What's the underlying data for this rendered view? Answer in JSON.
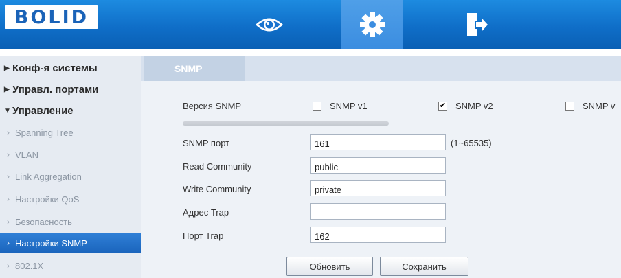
{
  "header": {
    "logo_text": "BOLID",
    "brand_color": "#0f6ec8",
    "tools": [
      {
        "name": "view",
        "icon": "eye-icon"
      },
      {
        "name": "settings",
        "icon": "gear-icon",
        "active": true
      },
      {
        "name": "exit",
        "icon": "exit-door-icon"
      }
    ]
  },
  "sidebar": {
    "groups": [
      {
        "label": "Конф-я системы",
        "expanded": false
      },
      {
        "label": "Управл. портами",
        "expanded": false
      },
      {
        "label": "Управление",
        "expanded": true
      }
    ],
    "items": [
      {
        "label": "Spanning Tree"
      },
      {
        "label": "VLAN"
      },
      {
        "label": "Link Aggregation"
      },
      {
        "label": "Настройки QoS"
      },
      {
        "label": "Безопасность"
      },
      {
        "label": "Настройки SNMP",
        "active": true
      },
      {
        "label": "802.1X"
      }
    ]
  },
  "tabs": [
    {
      "label": "SNMP",
      "active": true
    }
  ],
  "form": {
    "version_label": "Версия SNMP",
    "versions": [
      {
        "label": "SNMP v1",
        "checked": false
      },
      {
        "label": "SNMP v2",
        "checked": true
      },
      {
        "label": "SNMP v",
        "checked": false
      }
    ],
    "port_label": "SNMP порт",
    "port_value": "161",
    "port_range": "(1~65535)",
    "read_label": "Read Community",
    "read_value": "public",
    "write_label": "Write Community",
    "write_value": "private",
    "trap_addr_label": "Адрес Trap",
    "trap_addr_value": "",
    "trap_port_label": "Порт Trap",
    "trap_port_value": "162"
  },
  "buttons": {
    "refresh_label": "Обновить",
    "save_label": "Сохранить"
  },
  "colors": {
    "active_item": "#1f6ec4",
    "sidebar_bg": "#e6ebf2",
    "panel_bg": "#eef2f7"
  }
}
